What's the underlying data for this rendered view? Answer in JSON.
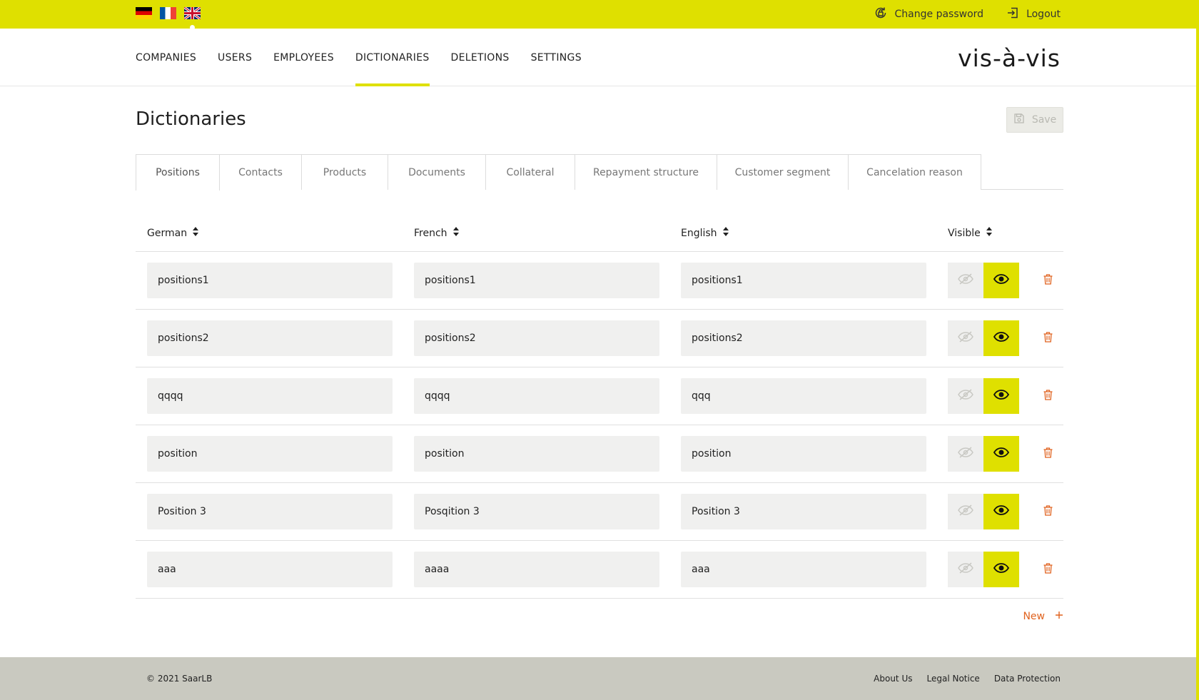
{
  "colors": {
    "accent": "#dfe000",
    "danger": "#e0621e",
    "footer_bg": "#c9c9c0"
  },
  "top_bar": {
    "flags": [
      "flag-de-icon",
      "flag-fr-icon",
      "flag-gb-icon"
    ],
    "change_password": "Change password",
    "logout": "Logout"
  },
  "nav": {
    "items": [
      "COMPANIES",
      "USERS",
      "EMPLOYEES",
      "DICTIONARIES",
      "DELETIONS",
      "SETTINGS"
    ],
    "active": "DICTIONARIES",
    "brand": "vis-à-vis"
  },
  "page": {
    "title": "Dictionaries",
    "save_label": "Save"
  },
  "tabs": [
    "Positions",
    "Contacts",
    "Products",
    "Documents",
    "Collateral",
    "Repayment structure",
    "Customer segment",
    "Cancelation reason"
  ],
  "active_tab": "Positions",
  "table": {
    "headers": [
      "German",
      "French",
      "English",
      "Visible"
    ],
    "rows": [
      [
        "positions1",
        "positions1",
        "positions1"
      ],
      [
        "positions2",
        "positions2",
        "positions2"
      ],
      [
        "qqqq",
        "qqqq",
        "qqq"
      ],
      [
        "position",
        "position",
        "position"
      ],
      [
        "Position 3",
        "Posqition 3",
        "Position 3"
      ],
      [
        "aaa",
        "aaaa",
        "aaa"
      ]
    ],
    "visible": [
      "visible",
      "visible",
      "visible",
      "visible",
      "visible",
      "visible"
    ]
  },
  "new_label": "New",
  "footer": {
    "copyright": "© 2021 SaarLB",
    "links": [
      "About Us",
      "Legal Notice",
      "Data Protection"
    ]
  }
}
